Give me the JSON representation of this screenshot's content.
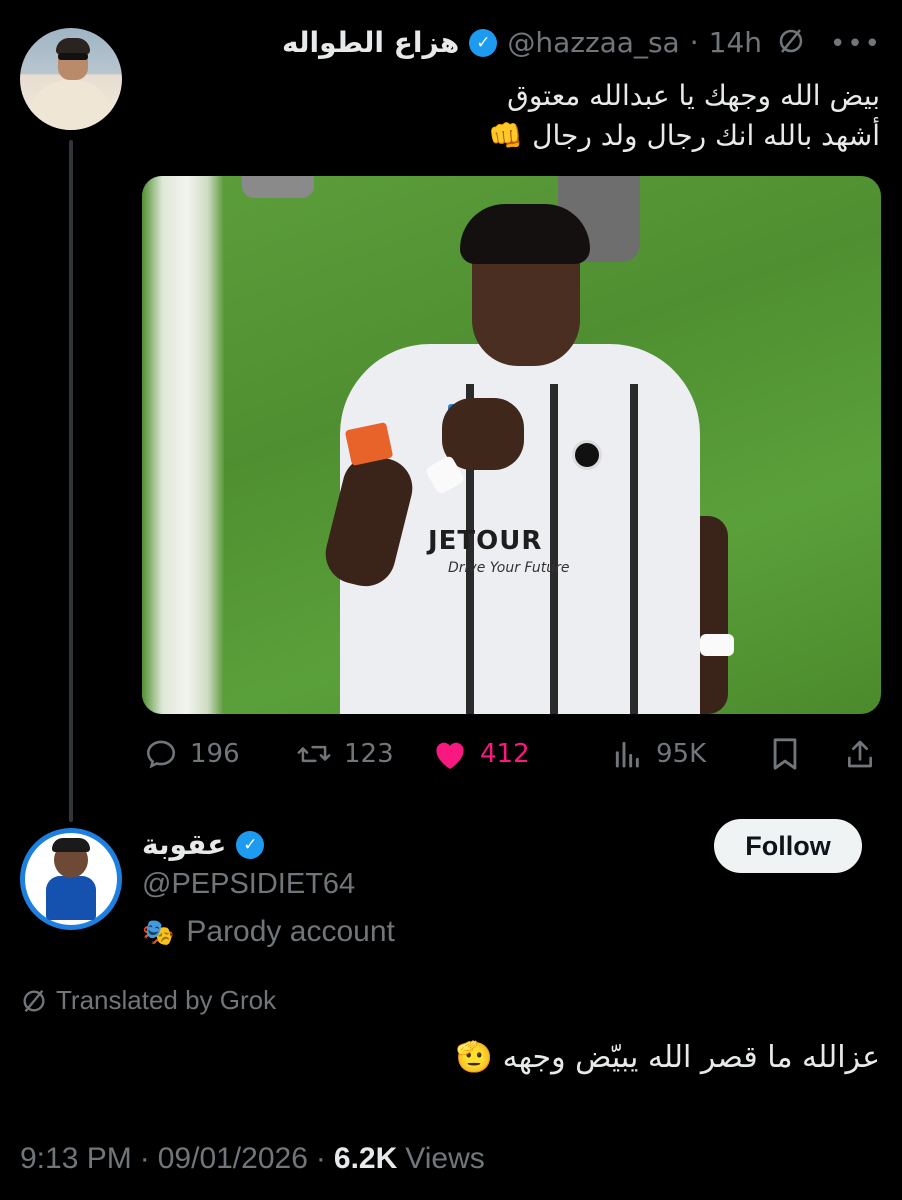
{
  "tweet": {
    "author_name": "هزاع الطواله",
    "handle": "@hazzaa_sa",
    "separator": "·",
    "time_ago": "14h",
    "text_line1": "بيض الله وجهك يا عبدالله معتوق",
    "text_line2": "أشهد بالله انك رجال ولد رجال 👊",
    "media": {
      "sponsor_text": "JETOUR",
      "sponsor_sub": "Drive Your Future"
    },
    "stats": {
      "replies": "196",
      "reposts": "123",
      "likes": "412",
      "views": "95K"
    },
    "more_label": "•••",
    "grok_icon": "grok-slash-icon"
  },
  "reply": {
    "author_name": "عقوبة",
    "handle": "@PEPSIDIET64",
    "parody_label": "Parody account",
    "follow_label": "Follow",
    "translated_label": "Translated by Grok",
    "text": "عزالله ما قصر الله يبيّض وجهه 🫡",
    "time": "9:13 PM",
    "date": "09/01/2026",
    "dot": "·",
    "views_count": "6.2K",
    "views_label": "Views"
  },
  "colors": {
    "background": "#000000",
    "text": "#e7e9ea",
    "muted": "#71767b",
    "like": "#f91880",
    "verified": "#1d9bf0"
  }
}
